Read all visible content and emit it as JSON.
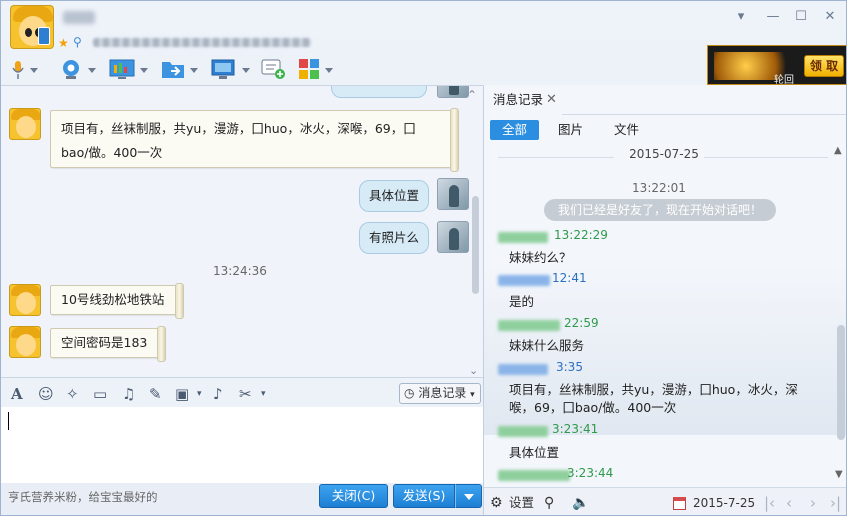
{
  "window": {
    "contact_info_text": "亨氏营养米粉，给宝宝最好的",
    "banner": {
      "sub_label": "轮回",
      "claim_label": "领 取"
    },
    "controls": {
      "menu": "▾",
      "minimize": "—",
      "maximize": "☐",
      "close": "✕"
    }
  },
  "toolbar": {
    "icons": [
      "microphone-icon",
      "webcam-icon",
      "screen-share-icon",
      "file-transfer-icon",
      "remote-desktop-icon",
      "chat-add-icon",
      "apps-grid-icon"
    ]
  },
  "chat": {
    "messages": [
      {
        "side": "left",
        "text": "项目有，丝袜制服，共yu，漫游，囗huo，冰火，深喉，69，囗bao/做。400一次"
      },
      {
        "side": "right",
        "text": "具体位置"
      },
      {
        "side": "right",
        "text": "有照片么"
      },
      {
        "side": "time",
        "text": "13:24:36"
      },
      {
        "side": "left",
        "text": "10号线劲松地铁站"
      },
      {
        "side": "left",
        "text": "空间密码是183"
      }
    ]
  },
  "input_toolbar": {
    "history_label": "消息记录"
  },
  "footer": {
    "close_label": "关闭(C)",
    "send_label": "发送(S)"
  },
  "history_panel": {
    "tab_label": "消息记录",
    "tab_close": "✕",
    "filters": [
      "全部",
      "图片",
      "文件"
    ],
    "date": "2015-07-25",
    "session_time": "13:22:01",
    "system_message": "我们已经是好友了，现在开始对话吧！",
    "entries": [
      {
        "time": "13:22:29",
        "text": "妹妹约么？",
        "color": "g"
      },
      {
        "time": "12:41",
        "text": "是的",
        "color": "b"
      },
      {
        "time": "22:59",
        "text": "妹妹什么服务",
        "color": "g"
      },
      {
        "time": "3:35",
        "text": "项目有，丝袜制服，共yu，漫游，囗huo，冰火，深喉，69，囗bao/做。400一次",
        "color": "b"
      },
      {
        "time": "3:23:41",
        "text": "具体位置",
        "color": "g"
      },
      {
        "time": "3:23:44",
        "text": "",
        "color": "g"
      }
    ],
    "footer": {
      "settings_label": "设置",
      "date": "2015-7-25"
    }
  }
}
